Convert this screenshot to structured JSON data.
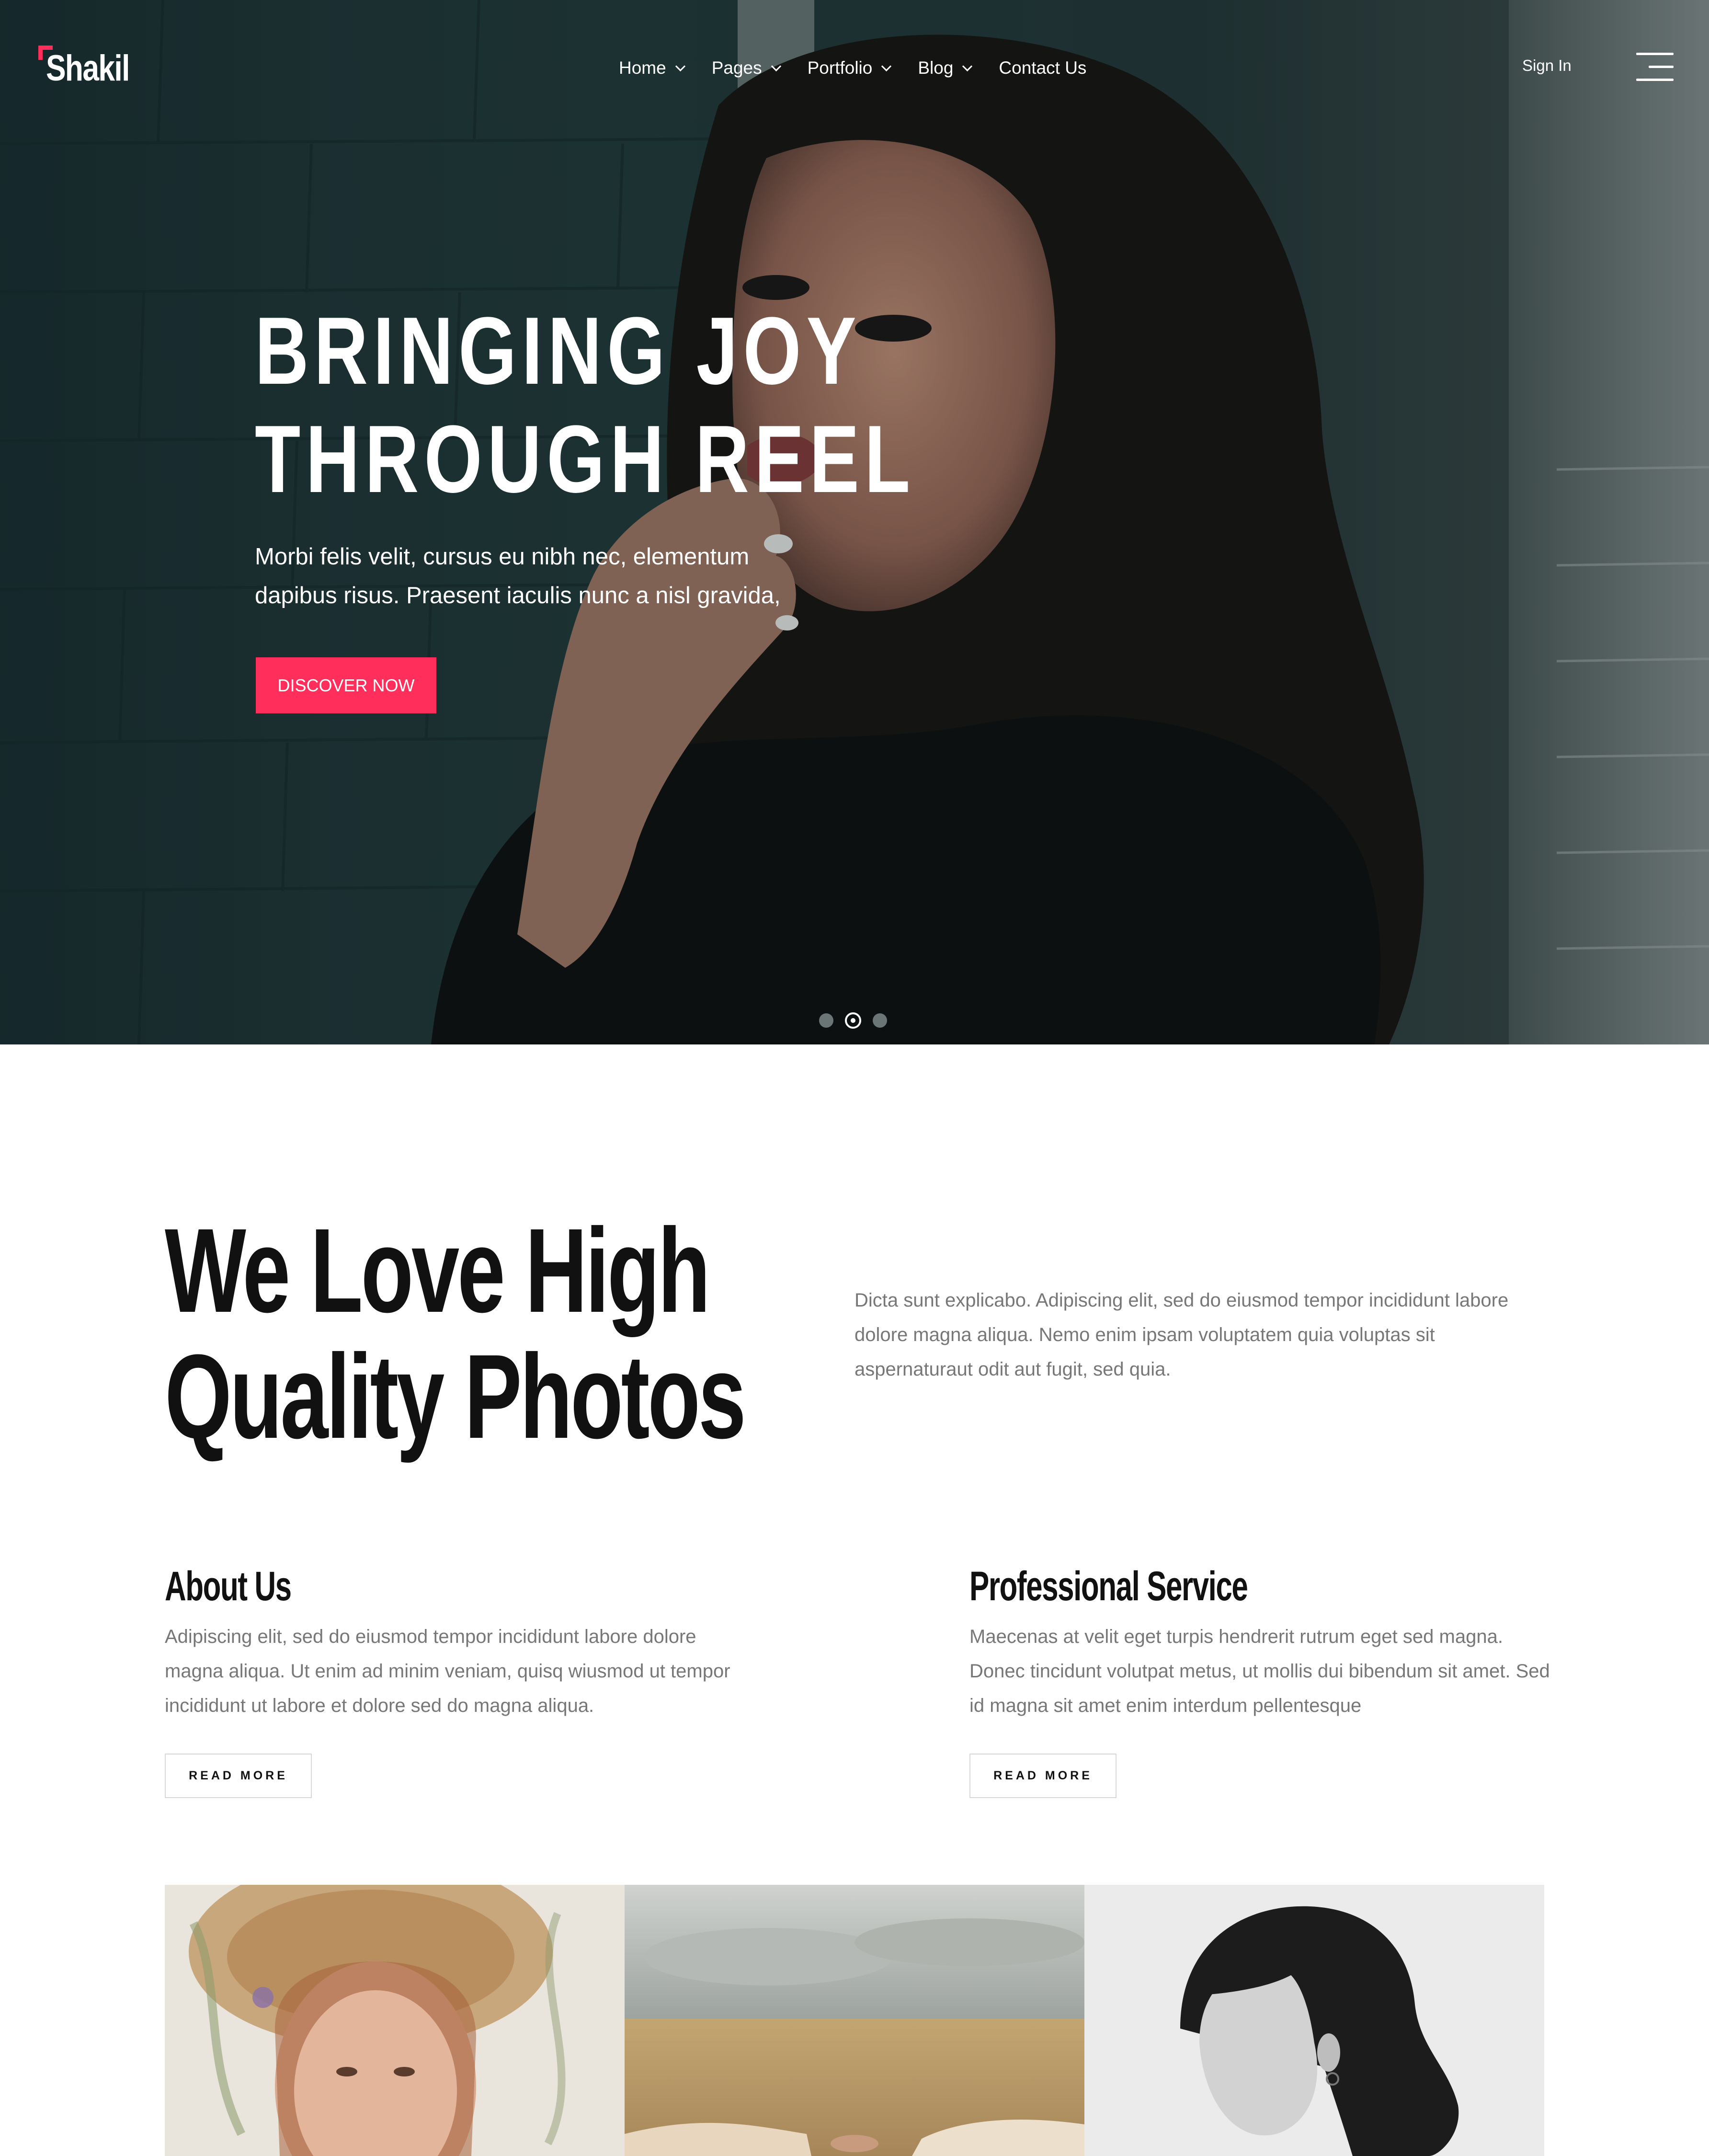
{
  "brand": {
    "name": "Shakil",
    "accent_color": "#ff2e5b"
  },
  "nav": {
    "items": [
      {
        "label": "Home",
        "has_dropdown": true
      },
      {
        "label": "Pages",
        "has_dropdown": true
      },
      {
        "label": "Portfolio",
        "has_dropdown": true
      },
      {
        "label": "Blog",
        "has_dropdown": true
      },
      {
        "label": "Contact Us",
        "has_dropdown": false
      }
    ],
    "sign_in": "Sign In",
    "menu_icon": "hamburger-menu-icon"
  },
  "hero": {
    "title_line1": "BRINGING JOY",
    "title_line2": "THROUGH REEL",
    "subtitle_line1": "Morbi felis velit, cursus eu nibh nec, elementum",
    "subtitle_line2": "dapibus risus. Praesent iaculis nunc a nisl gravida,",
    "cta_label": "DISCOVER NOW",
    "slides_total": 3,
    "active_slide": 2
  },
  "intro": {
    "title_line1": "We Love High",
    "title_line2": "Quality Photos",
    "text": "Dicta sunt explicabo. Adipiscing elit, sed do eiusmod tempor incididunt labore dolore magna aliqua. Nemo enim ipsam voluptatem quia voluptas sit aspernaturaut odit aut fugit, sed quia."
  },
  "cards": [
    {
      "title": "About Us",
      "text": "Adipiscing elit, sed do eiusmod tempor incididunt labore dolore magna aliqua. Ut enim ad minim veniam, quisq wiusmod ut tempor incididunt ut labore et dolore sed do magna aliqua.",
      "button": "READ MORE"
    },
    {
      "title": "Professional Service",
      "text": "Maecenas at velit eget turpis hendrerit rutrum eget sed magna. Donec tincidunt volutpat metus, ut mollis dui bibendum sit amet. Sed id magna sit amet enim interdum pellentesque",
      "button": "READ MORE"
    }
  ],
  "gallery": {
    "items": [
      "woman-straw-hat-photo",
      "wheat-field-photo",
      "woman-profile-bw-photo"
    ]
  }
}
